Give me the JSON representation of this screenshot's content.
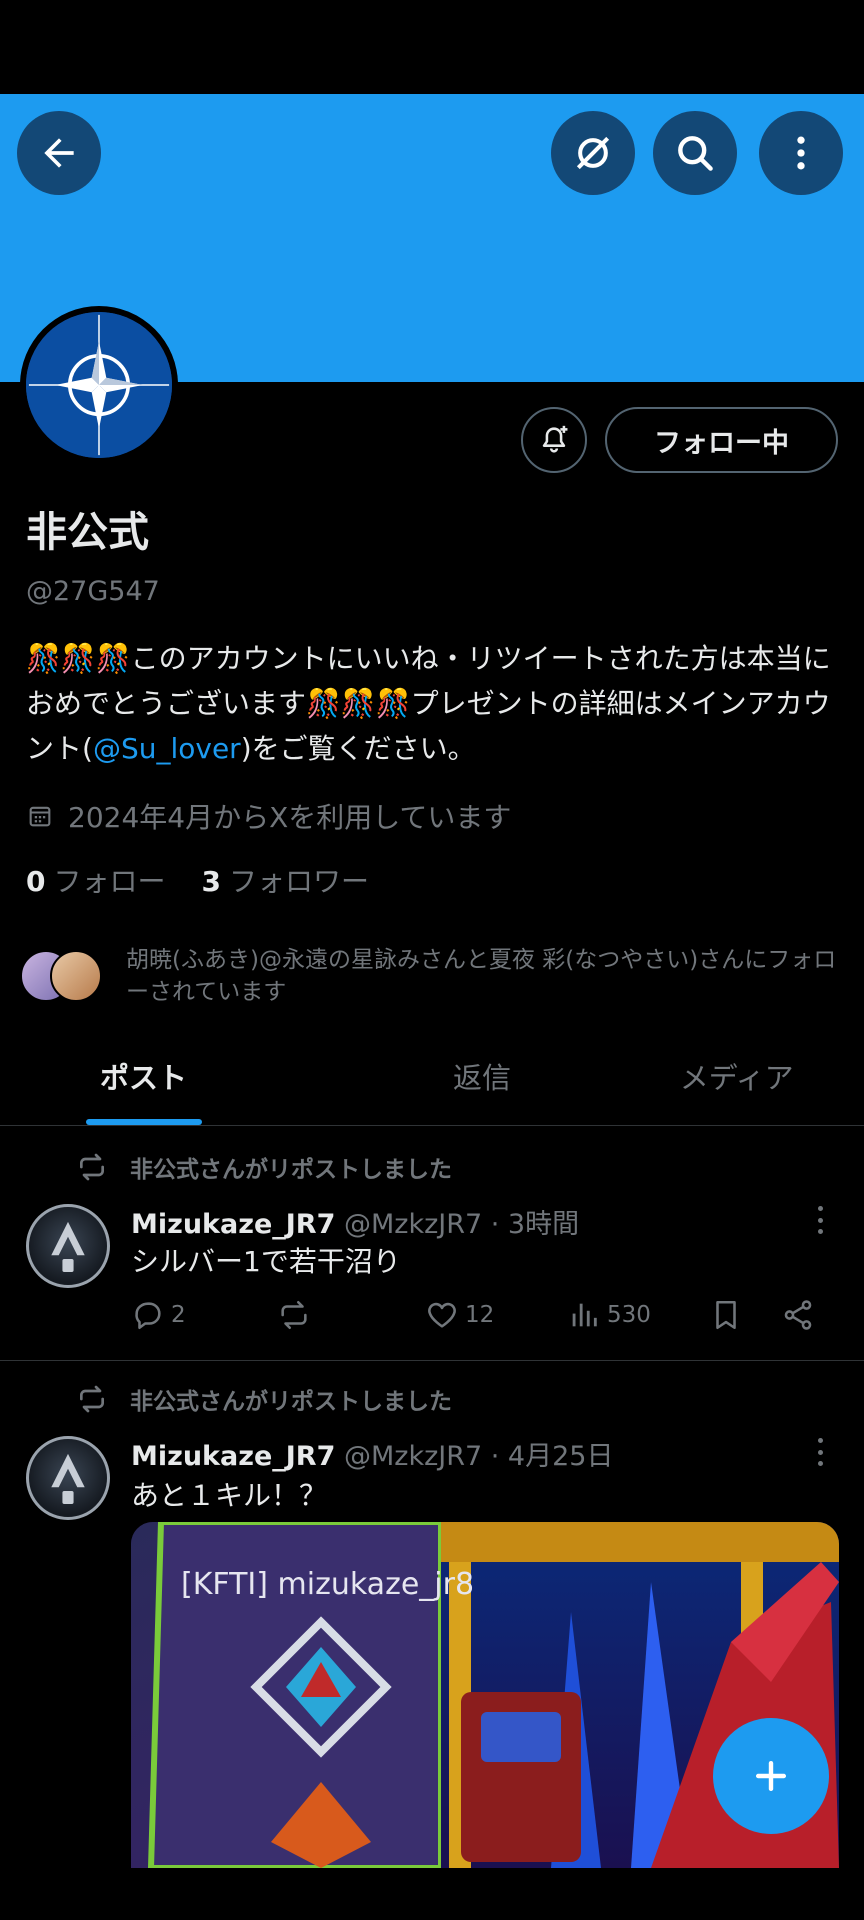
{
  "header": {
    "back_icon": "arrow-left-icon",
    "grok_icon": "grok-icon",
    "search_icon": "search-icon",
    "more_icon": "more-vertical-icon",
    "banner_color": "#1d9bf0"
  },
  "profile": {
    "display_name": "非公式",
    "handle": "@27G547",
    "bio_before": "🎊🎊🎊このアカウントにいいね・リツイートされた方は本当におめでとうございます🎊🎊🎊プレゼントの詳細はメインアカウント(",
    "bio_link": "@Su_lover",
    "bio_after": ")をご覧ください。",
    "joined": "2024年4月からXを利用しています",
    "following_count": "0",
    "following_label": "フォロー",
    "followers_count": "3",
    "followers_label": "フォロワー",
    "follow_button": "フォロー中",
    "mutuals_text": "胡暁(ふあき)@永遠の星詠みさんと夏夜 彩(なつやさい)さんにフォローされています"
  },
  "tabs": [
    {
      "label": "ポスト",
      "active": true
    },
    {
      "label": "返信",
      "active": false
    },
    {
      "label": "メディア",
      "active": false
    }
  ],
  "posts": [
    {
      "repost_label": "非公式さんがリポストしました",
      "name": "Mizukaze_JR7",
      "meta": "@MzkzJR7 · 3時間",
      "text": "シルバー1で若干沼り",
      "replies": "2",
      "likes": "12",
      "views": "530"
    },
    {
      "repost_label": "非公式さんがリポストしました",
      "name": "Mizukaze_JR7",
      "meta": "@MzkzJR7 · 4月25日",
      "text": "あと１キル！？",
      "media_caption": "[KFTI] mizukaze_jr8"
    }
  ],
  "fab_icon": "plus-icon"
}
